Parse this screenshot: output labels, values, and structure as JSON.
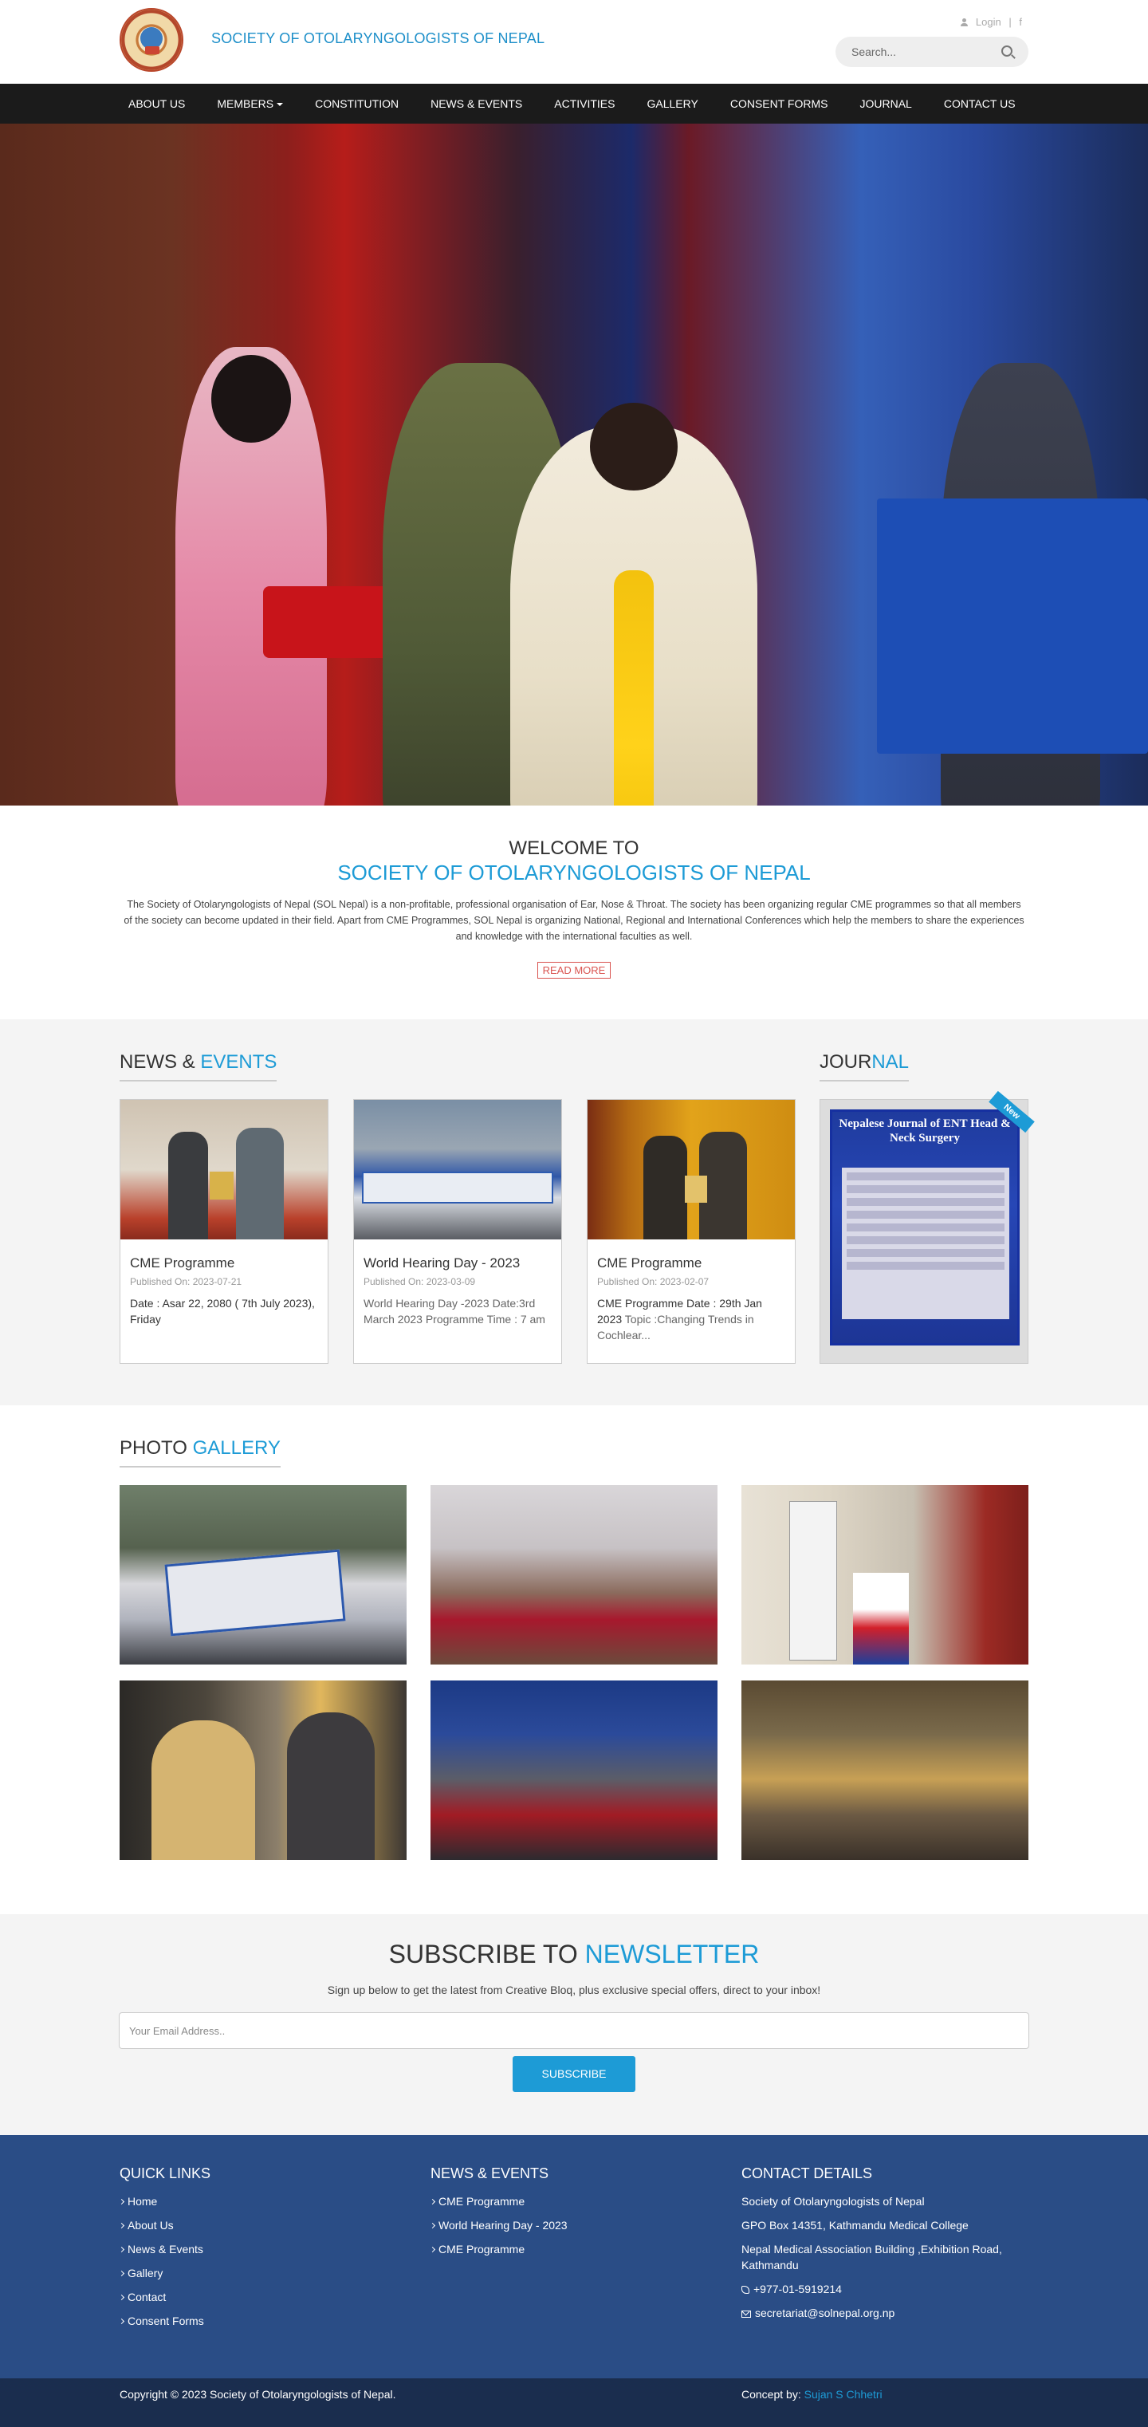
{
  "header": {
    "site_title": "SOCIETY OF OTOLARYNGOLOGISTS OF NEPAL",
    "login_label": "Login",
    "separator": "|",
    "facebook_glyph": "f",
    "search_placeholder": "Search..."
  },
  "nav": {
    "items": [
      {
        "label": "ABOUT US"
      },
      {
        "label": "MEMBERS"
      },
      {
        "label": "CONSTITUTION"
      },
      {
        "label": "NEWS & EVENTS"
      },
      {
        "label": "ACTIVITIES"
      },
      {
        "label": "GALLERY"
      },
      {
        "label": "CONSENT FORMS"
      },
      {
        "label": "JOURNAL"
      },
      {
        "label": "CONTACT US"
      }
    ]
  },
  "welcome": {
    "heading": "WELCOME TO",
    "subheading": "SOCIETY OF OTOLARYNGOLOGISTS OF NEPAL",
    "body": "The Society of Otolaryngologists of Nepal (SOL Nepal) is a non-profitable, professional organisation of Ear, Nose & Throat. The society has been organizing regular CME programmes so that all members of the society can become updated in their field. Apart from CME Programmes, SOL Nepal is organizing National, Regional and International Conferences which help the members to share the experiences and knowledge with the international faculties as well.",
    "read_more": "READ MORE"
  },
  "news": {
    "title_part1": "NEWS & ",
    "title_part2": "EVENTS",
    "items": [
      {
        "title": "CME Programme",
        "published": "Published On: 2023-07-21",
        "desc": "Date : Asar 22, 2080 ( 7th July 2023), Friday",
        "desc_extra": ""
      },
      {
        "title": "World Hearing Day - 2023",
        "published": "Published On: 2023-03-09",
        "desc": "",
        "desc_extra": "World Hearing Day -2023 Date:3rd March 2023 Programme Time : 7 am"
      },
      {
        "title": "CME Programme",
        "published": "Published On: 2023-02-07",
        "desc": "CME Programme    Date :  29th Jan 2023",
        "desc_extra": " Topic :Changing Trends in Cochlear..."
      }
    ]
  },
  "journal": {
    "title_part1": "JOUR",
    "title_part2": "NAL",
    "cover_title": "Nepalese Journal of ENT Head & Neck Surgery",
    "ribbon": "New"
  },
  "gallery": {
    "title_part1": "PHOTO ",
    "title_part2": "GALLERY"
  },
  "newsletter": {
    "title_part1": "SUBSCRIBE TO ",
    "title_part2": "NEWSLETTER",
    "text": "Sign up below to get the latest from Creative Bloq, plus exclusive special offers, direct to your inbox!",
    "email_placeholder": "Your Email Address..",
    "button": "SUBSCRIBE"
  },
  "footer": {
    "quick_links_title": "QUICK LINKS",
    "quick_links": [
      "Home",
      "About Us",
      "News & Events",
      "Gallery",
      "Contact",
      "Consent Forms"
    ],
    "news_title": "NEWS & EVENTS",
    "news_links": [
      "CME Programme",
      "World Hearing Day - 2023",
      "CME Programme"
    ],
    "contact_title": "CONTACT DETAILS",
    "contact_name": "Society of Otolaryngologists of Nepal",
    "contact_box": "GPO Box 14351, Kathmandu Medical College",
    "contact_building": "Nepal Medical Association Building ,Exhibition Road, Kathmandu",
    "phone": "+977-01-5919214",
    "email": "secretariat@solnepal.org.np"
  },
  "copyright": {
    "text": "Copyright © 2023 Society of Otolaryngologists of Nepal.",
    "concept_label": "Concept by:",
    "concept_name": "Sujan S Chhetri"
  }
}
